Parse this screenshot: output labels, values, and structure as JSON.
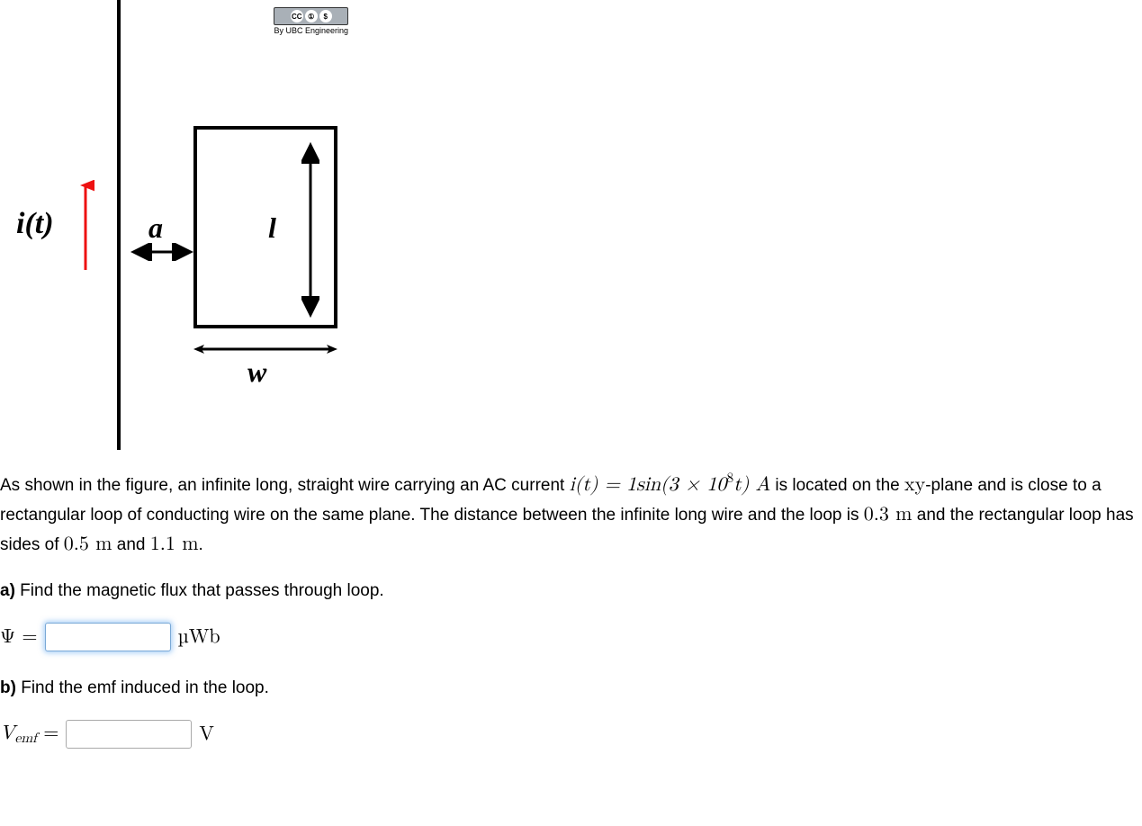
{
  "figure": {
    "cc_caption": "By UBC Engineering",
    "current_label": "i(t)",
    "dist_label": "a",
    "length_label": "l",
    "width_label": "w"
  },
  "intro_1": "As shown in the figure, an infinite long, straight wire carrying an AC current ",
  "intro_formula_left": "i(t) = 1sin(3 × 10",
  "intro_formula_sup": "8",
  "intro_formula_right": "t) A",
  "intro_2": " is located on the ",
  "intro_plane": "xy",
  "intro_3": "-plane and is close to a rectangular loop of conducting wire on the same plane. The distance between the infinite long wire and the loop is ",
  "val_a": "0.3 m",
  "intro_4": " and the rectangular loop has sides of ",
  "val_w": "0.5 m",
  "intro_5": " and ",
  "val_l": "1.1 m",
  "intro_6": ".",
  "part_a_label": "a)",
  "part_a_text": " Find the magnetic flux that passes through loop.",
  "psi_eq": "Ψ = ",
  "psi_unit": "µWb",
  "part_b_label": "b)",
  "part_b_text": " Find the emf induced in the loop.",
  "vemf_V": "V",
  "vemf_sub": "emf",
  "vemf_eq": " = ",
  "vemf_unit": "V",
  "inputs": {
    "psi": "",
    "vemf": ""
  }
}
